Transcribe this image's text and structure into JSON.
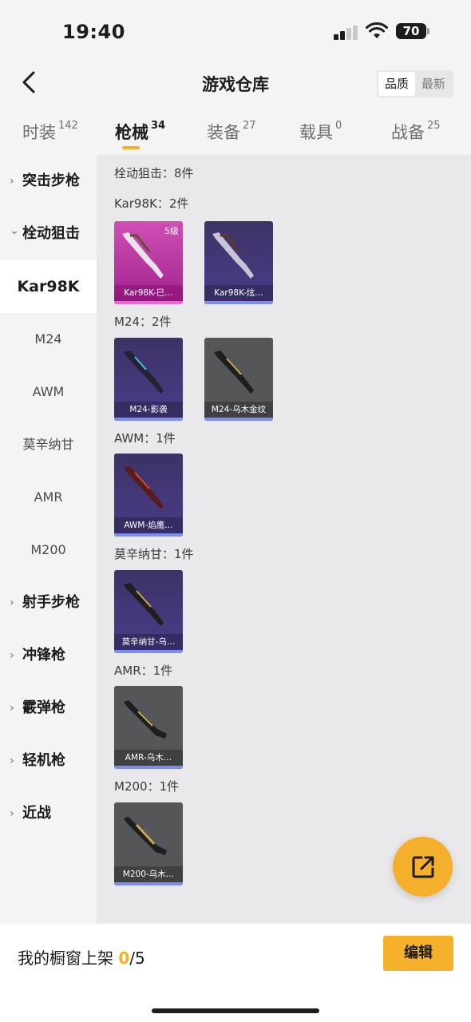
{
  "status": {
    "time": "19:40",
    "battery": "70"
  },
  "nav": {
    "title": "游戏仓库",
    "sort_options": [
      "品质",
      "最新"
    ],
    "sort_selected": "品质"
  },
  "tabs": [
    {
      "label": "时装",
      "count": "142"
    },
    {
      "label": "枪械",
      "count": "34"
    },
    {
      "label": "装备",
      "count": "27"
    },
    {
      "label": "载具",
      "count": "0"
    },
    {
      "label": "战备",
      "count": "25"
    }
  ],
  "sidebar": [
    {
      "label": "突击步枪",
      "kind": "category",
      "chevron": "›"
    },
    {
      "label": "栓动狙击",
      "kind": "category",
      "chevron": "⌄"
    },
    {
      "label": "Kar98K",
      "kind": "sub"
    },
    {
      "label": "M24",
      "kind": "sub"
    },
    {
      "label": "AWM",
      "kind": "sub"
    },
    {
      "label": "莫辛纳甘",
      "kind": "sub"
    },
    {
      "label": "AMR",
      "kind": "sub"
    },
    {
      "label": "M200",
      "kind": "sub"
    },
    {
      "label": "射手步枪",
      "kind": "category",
      "chevron": "›"
    },
    {
      "label": "冲锋枪",
      "kind": "category",
      "chevron": "›"
    },
    {
      "label": "霰弹枪",
      "kind": "category",
      "chevron": "›"
    },
    {
      "label": "轻机枪",
      "kind": "category",
      "chevron": "›"
    },
    {
      "label": "近战",
      "kind": "category",
      "chevron": "›"
    }
  ],
  "main": {
    "summary": "栓动狙击：8件",
    "groups": [
      {
        "label": "Kar98K：2件",
        "items": [
          {
            "name": "Kar98K-巳…",
            "level": "5级",
            "tier": "pink"
          },
          {
            "name": "Kar98K-炫…",
            "tier": "purple"
          }
        ]
      },
      {
        "label": "M24：2件",
        "items": [
          {
            "name": "M24-影袭",
            "tier": "purple"
          },
          {
            "name": "M24-乌木金纹",
            "tier": "gray"
          }
        ]
      },
      {
        "label": "AWM：1件",
        "items": [
          {
            "name": "AWM-焰鹰…",
            "tier": "purple"
          }
        ]
      },
      {
        "label": "莫辛纳甘：1件",
        "items": [
          {
            "name": "莫辛纳甘-乌…",
            "tier": "purple"
          }
        ]
      },
      {
        "label": "AMR：1件",
        "items": [
          {
            "name": "AMR-乌木…",
            "tier": "gray"
          }
        ]
      },
      {
        "label": "M200：1件",
        "items": [
          {
            "name": "M200-乌木…",
            "tier": "gray"
          }
        ]
      }
    ]
  },
  "bottom": {
    "shelf_label": "我的橱窗上架",
    "shelf_current": "0",
    "shelf_total": "/5",
    "edit_label": "编辑"
  },
  "colors": {
    "accent": "#f5b12a",
    "pink_tier": "#c23aa8",
    "purple_tier": "#3f3472",
    "gray_tier": "#55565a"
  },
  "icons": [
    "chevron-left-icon",
    "signal-icon",
    "wifi-icon",
    "battery-icon",
    "share-external-icon",
    "rifle-icon"
  ]
}
